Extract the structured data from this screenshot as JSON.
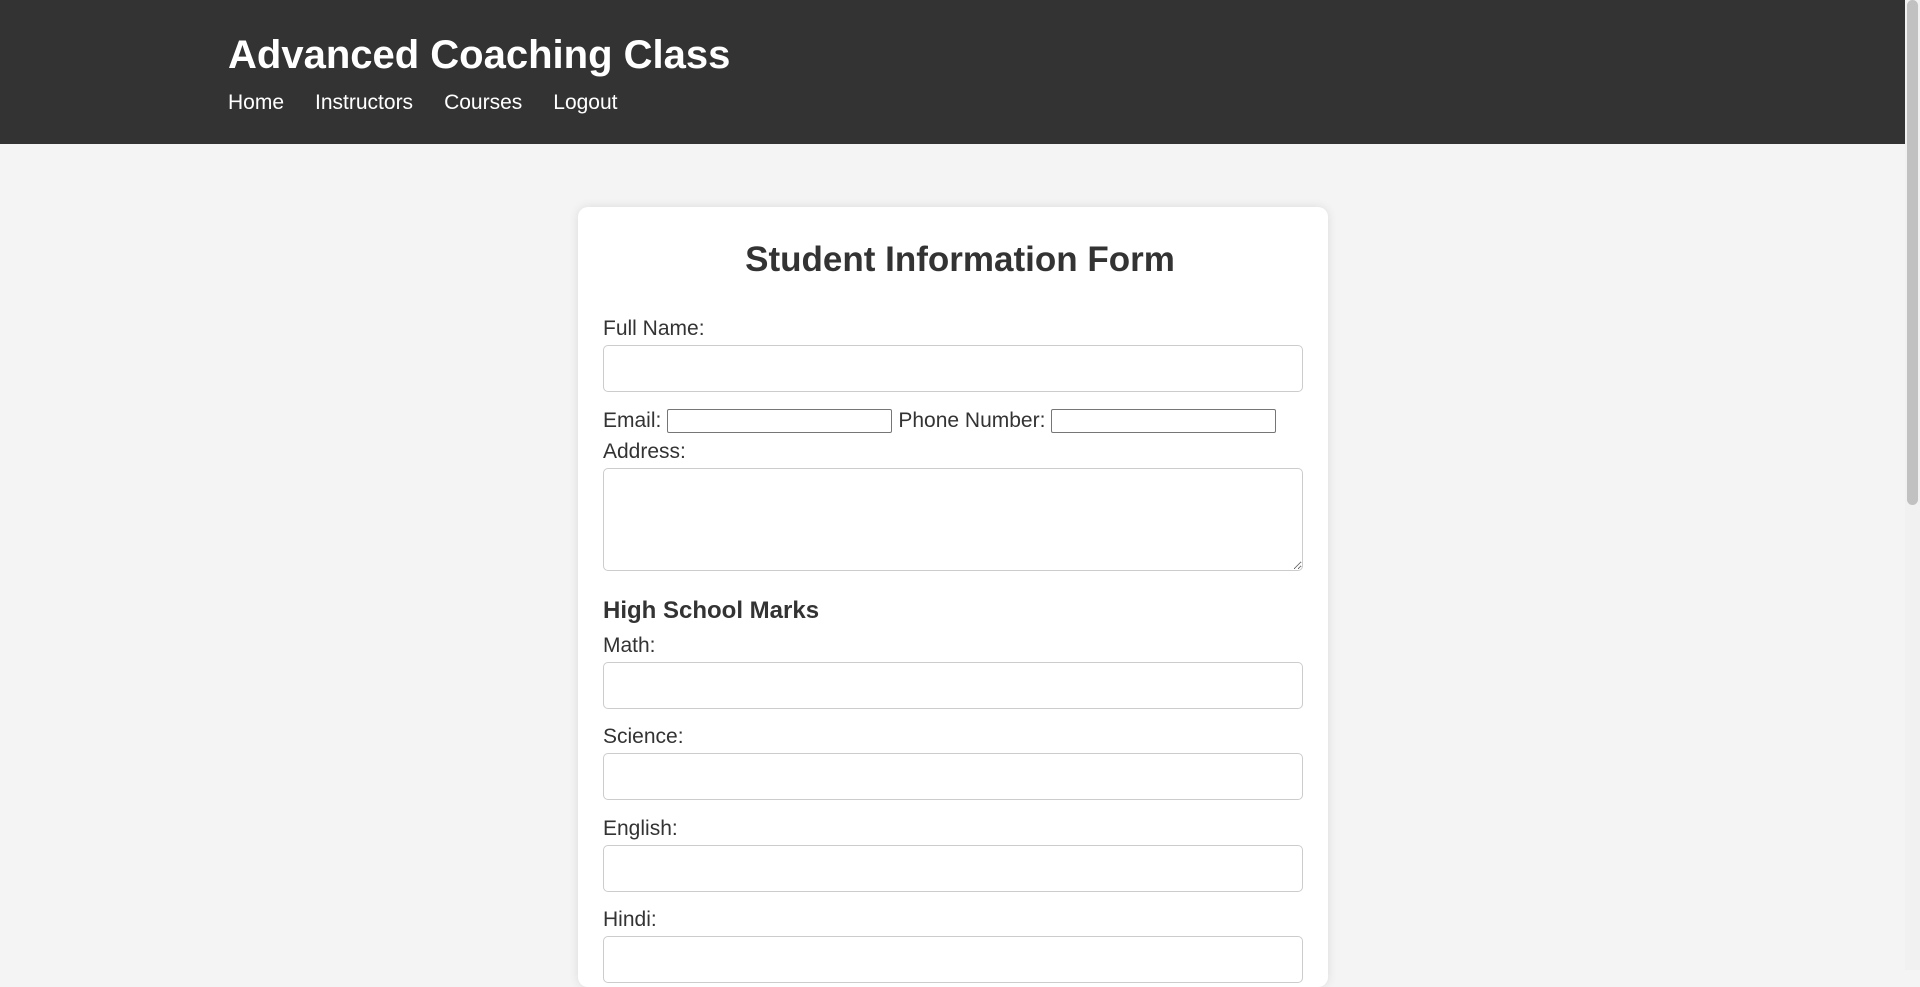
{
  "header": {
    "title": "Advanced Coaching Class",
    "nav": [
      "Home",
      "Instructors",
      "Courses",
      "Logout"
    ]
  },
  "form": {
    "title": "Student Information Form",
    "full_name": {
      "label": "Full Name:",
      "value": ""
    },
    "email": {
      "label": "Email:",
      "value": ""
    },
    "phone": {
      "label": "Phone Number:",
      "value": ""
    },
    "address": {
      "label": "Address:",
      "value": ""
    },
    "marks_heading": "High School Marks",
    "marks": [
      {
        "label": "Math:",
        "value": ""
      },
      {
        "label": "Science:",
        "value": ""
      },
      {
        "label": "English:",
        "value": ""
      },
      {
        "label": "Hindi:",
        "value": ""
      }
    ]
  },
  "colors": {
    "header_bg": "#333333",
    "page_bg": "#f4f4f4",
    "card_bg": "#ffffff",
    "text": "#333333"
  }
}
